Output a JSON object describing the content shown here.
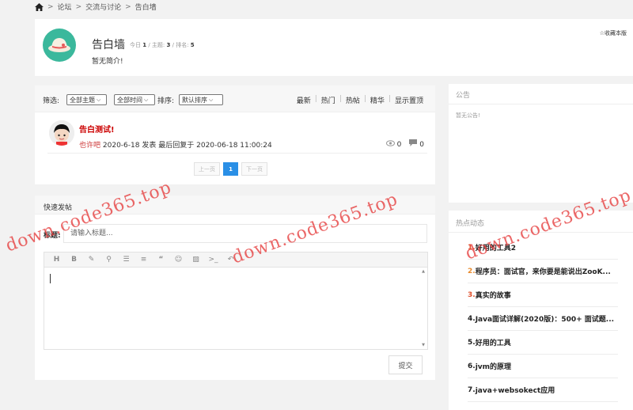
{
  "breadcrumb": {
    "items": [
      "论坛",
      "交流与讨论",
      "告白墙"
    ],
    "separator": ">"
  },
  "forum": {
    "title": "告白墙",
    "stats": {
      "today_label": "今日",
      "today": "1",
      "topics_label": "主题",
      "topics": "3",
      "rank_label": "排名",
      "rank": "5"
    },
    "description": "暂无简介!",
    "favorite_label": "☆收藏本版"
  },
  "filters": {
    "filter_label": "筛选:",
    "topic_select": "全部主题",
    "time_select": "全部时间",
    "sort_label": "排序:",
    "sort_select": "默认排序",
    "sort_links": [
      "最新",
      "热门",
      "热帖",
      "精华",
      "显示置顶"
    ]
  },
  "threads": [
    {
      "title": "告白测试!",
      "author": "也许吧",
      "date": "2020-6-18",
      "posted_label": "发表",
      "last_reply_label": "最后回复于",
      "last_reply": "2020-06-18 11:00:24",
      "views": "0",
      "replies": "0"
    }
  ],
  "pagination": {
    "prev": "上一页",
    "current": "1",
    "next": "下一页"
  },
  "quick_post": {
    "header": "快速发帖",
    "title_label": "标题:",
    "title_placeholder": "请输入标题...",
    "submit": "提交",
    "toolbar_icons": [
      "heading-icon",
      "bold-icon",
      "brush-icon",
      "link-icon",
      "bullet-list-icon",
      "align-icon",
      "quote-icon",
      "emoji-icon",
      "image-icon",
      "code-icon",
      "undo-icon"
    ]
  },
  "notice": {
    "title": "公告",
    "text": "暂无公告!"
  },
  "hot": {
    "title": "热点动态",
    "items": [
      {
        "rank": "1.",
        "text": "好用的工具2"
      },
      {
        "rank": "2.",
        "text": "程序员：面试官，来你要是能说出ZooK..."
      },
      {
        "rank": "3.",
        "text": "真实的故事"
      },
      {
        "rank": "4.",
        "text": "Java面试详解(2020版)：500+ 面试题..."
      },
      {
        "rank": "5.",
        "text": "好用的工具"
      },
      {
        "rank": "6.",
        "text": "jvm的原理"
      },
      {
        "rank": "7.",
        "text": "java+websokect应用"
      }
    ]
  },
  "watermark": "down.code365.top",
  "colors": {
    "accent_blue": "#2a8fe6",
    "title_red": "#cc0000",
    "avatar_teal": "#3bb89c"
  }
}
